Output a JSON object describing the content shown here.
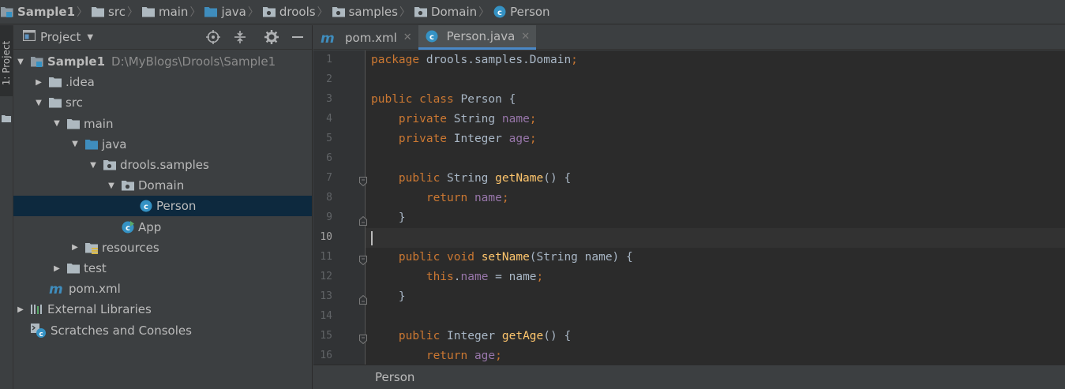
{
  "breadcrumb": [
    {
      "label": "Sample1",
      "icon": "module-icon",
      "bold": true
    },
    {
      "label": "src",
      "icon": "folder-icon"
    },
    {
      "label": "main",
      "icon": "folder-icon"
    },
    {
      "label": "java",
      "icon": "source-folder-icon"
    },
    {
      "label": "drools",
      "icon": "package-icon"
    },
    {
      "label": "samples",
      "icon": "package-icon"
    },
    {
      "label": "Domain",
      "icon": "package-icon"
    },
    {
      "label": "Person",
      "icon": "class-icon"
    }
  ],
  "left_strip": {
    "tab_label": "1: Project"
  },
  "project_panel": {
    "title": "Project",
    "tools": [
      "locate-icon",
      "collapse-all-icon",
      "settings-icon",
      "hide-icon"
    ]
  },
  "tree": [
    {
      "label": "Sample1",
      "path": "D:\\MyBlogs\\Drools\\Sample1",
      "depth": 0,
      "arrow": "expanded",
      "icon": "module",
      "bold": true
    },
    {
      "label": ".idea",
      "depth": 1,
      "arrow": "collapsed",
      "icon": "folder"
    },
    {
      "label": "src",
      "depth": 1,
      "arrow": "expanded",
      "icon": "folder"
    },
    {
      "label": "main",
      "depth": 2,
      "arrow": "expanded",
      "icon": "folder"
    },
    {
      "label": "java",
      "depth": 3,
      "arrow": "expanded",
      "icon": "source-folder"
    },
    {
      "label": "drools.samples",
      "depth": 4,
      "arrow": "expanded",
      "icon": "package"
    },
    {
      "label": "Domain",
      "depth": 5,
      "arrow": "expanded",
      "icon": "package"
    },
    {
      "label": "Person",
      "depth": 6,
      "arrow": "none",
      "icon": "class",
      "selected": true
    },
    {
      "label": "App",
      "depth": 5,
      "arrow": "none",
      "icon": "main-class"
    },
    {
      "label": "resources",
      "depth": 3,
      "arrow": "collapsed",
      "icon": "resources-folder"
    },
    {
      "label": "test",
      "depth": 2,
      "arrow": "collapsed",
      "icon": "folder"
    },
    {
      "label": "pom.xml",
      "depth": 1,
      "arrow": "none",
      "icon": "maven"
    },
    {
      "label": "External Libraries",
      "depth": 0,
      "arrow": "collapsed",
      "icon": "libraries"
    },
    {
      "label": "Scratches and Consoles",
      "depth": 0,
      "arrow": "none",
      "icon": "scratches"
    }
  ],
  "tabs": [
    {
      "label": "pom.xml",
      "icon": "maven-icon",
      "active": false
    },
    {
      "label": "Person.java",
      "icon": "class-icon",
      "active": true
    }
  ],
  "editor": {
    "current_line": 10,
    "lines": [
      {
        "n": "1",
        "tokens": [
          [
            "kw",
            "package "
          ],
          [
            "cls",
            "drools.samples.Domain"
          ],
          [
            "punc",
            ";"
          ]
        ]
      },
      {
        "n": "2",
        "tokens": []
      },
      {
        "n": "3",
        "tokens": [
          [
            "kw",
            "public class "
          ],
          [
            "cls",
            "Person "
          ],
          [
            "cls",
            "{"
          ]
        ]
      },
      {
        "n": "4",
        "tokens": [
          [
            "cls",
            "    "
          ],
          [
            "kw",
            "private "
          ],
          [
            "cls",
            "String "
          ],
          [
            "fld",
            "name"
          ],
          [
            "punc",
            ";"
          ]
        ]
      },
      {
        "n": "5",
        "tokens": [
          [
            "cls",
            "    "
          ],
          [
            "kw",
            "private "
          ],
          [
            "cls",
            "Integer "
          ],
          [
            "fld",
            "age"
          ],
          [
            "punc",
            ";"
          ]
        ]
      },
      {
        "n": "6",
        "tokens": []
      },
      {
        "n": "7",
        "fold": "start",
        "tokens": [
          [
            "cls",
            "    "
          ],
          [
            "kw",
            "public "
          ],
          [
            "cls",
            "String "
          ],
          [
            "fn",
            "getName"
          ],
          [
            "cls",
            "() {"
          ]
        ]
      },
      {
        "n": "8",
        "tokens": [
          [
            "cls",
            "        "
          ],
          [
            "kw",
            "return "
          ],
          [
            "fld",
            "name"
          ],
          [
            "punc",
            ";"
          ]
        ]
      },
      {
        "n": "9",
        "fold": "end",
        "tokens": [
          [
            "cls",
            "    }"
          ]
        ]
      },
      {
        "n": "10",
        "tokens": []
      },
      {
        "n": "11",
        "fold": "start",
        "tokens": [
          [
            "cls",
            "    "
          ],
          [
            "kw",
            "public void "
          ],
          [
            "fn",
            "setName"
          ],
          [
            "cls",
            "(String name) {"
          ]
        ]
      },
      {
        "n": "12",
        "tokens": [
          [
            "cls",
            "        "
          ],
          [
            "kw",
            "this"
          ],
          [
            "cls",
            "."
          ],
          [
            "fld",
            "name"
          ],
          [
            "cls",
            " = name"
          ],
          [
            "punc",
            ";"
          ]
        ]
      },
      {
        "n": "13",
        "fold": "end",
        "tokens": [
          [
            "cls",
            "    }"
          ]
        ]
      },
      {
        "n": "14",
        "tokens": []
      },
      {
        "n": "15",
        "fold": "start",
        "tokens": [
          [
            "cls",
            "    "
          ],
          [
            "kw",
            "public "
          ],
          [
            "cls",
            "Integer "
          ],
          [
            "fn",
            "getAge"
          ],
          [
            "cls",
            "() {"
          ]
        ]
      },
      {
        "n": "16",
        "tokens": [
          [
            "cls",
            "        "
          ],
          [
            "kw",
            "return "
          ],
          [
            "fld",
            "age"
          ],
          [
            "punc",
            ";"
          ]
        ]
      }
    ]
  },
  "footer": {
    "breadcrumb": "Person"
  },
  "colors": {
    "background": "#2b2b2b",
    "panel": "#3c3f41",
    "selection": "#0d293e",
    "keyword": "#cc7832",
    "field": "#9876aa",
    "method": "#ffc66d",
    "text": "#a9b7c6",
    "class_icon": "#3592c4"
  }
}
